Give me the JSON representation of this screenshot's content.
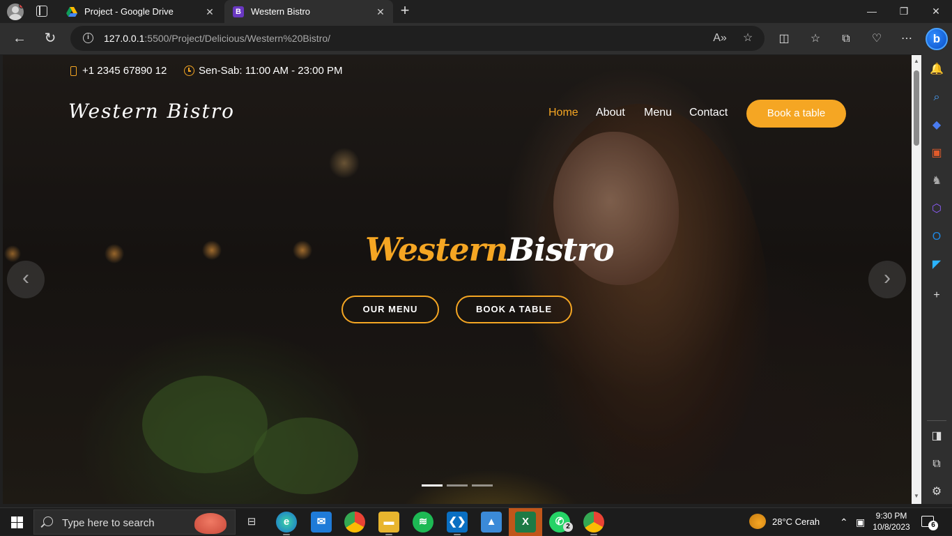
{
  "browser": {
    "tabs": [
      {
        "title": "Project - Google Drive",
        "icon": "google-drive-icon"
      },
      {
        "title": "Western Bistro",
        "icon": "bootstrap-icon",
        "icon_letter": "B",
        "active": true
      }
    ],
    "new_tab_symbol": "+",
    "url_host": "127.0.0.1",
    "url_rest": ":5500/Project/Delicious/Western%20Bistro/"
  },
  "site": {
    "phone": "+1 2345 67890 12",
    "hours": "Sen-Sab: 11:00 AM - 23:00 PM",
    "brand": "Western Bistro",
    "nav": {
      "home": "Home",
      "about": "About",
      "menu": "Menu",
      "contact": "Contact"
    },
    "book_button": "Book a table",
    "hero": {
      "title_part1": "Western",
      "title_part2": "Bistro",
      "btn_menu": "OUR MENU",
      "btn_book": "BOOK A TABLE"
    },
    "carousel": {
      "slides": 3,
      "active_index": 0
    }
  },
  "taskbar": {
    "search_placeholder": "Type here to search",
    "weather": "28°C  Cerah",
    "time": "9:30 PM",
    "date": "10/8/2023",
    "whatsapp_badge": "2",
    "notification_count": "6"
  },
  "colors": {
    "accent": "#f5a623",
    "browser_bg": "#202020",
    "toolbar_bg": "#2f2f2f"
  }
}
